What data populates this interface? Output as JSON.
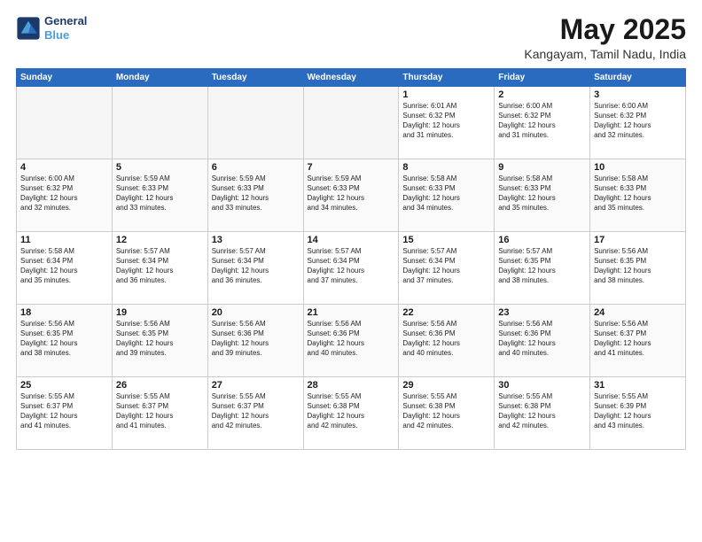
{
  "header": {
    "logo_line1": "General",
    "logo_line2": "Blue",
    "month": "May 2025",
    "location": "Kangayam, Tamil Nadu, India"
  },
  "weekdays": [
    "Sunday",
    "Monday",
    "Tuesday",
    "Wednesday",
    "Thursday",
    "Friday",
    "Saturday"
  ],
  "weeks": [
    [
      {
        "day": "",
        "info": ""
      },
      {
        "day": "",
        "info": ""
      },
      {
        "day": "",
        "info": ""
      },
      {
        "day": "",
        "info": ""
      },
      {
        "day": "1",
        "info": "Sunrise: 6:01 AM\nSunset: 6:32 PM\nDaylight: 12 hours\nand 31 minutes."
      },
      {
        "day": "2",
        "info": "Sunrise: 6:00 AM\nSunset: 6:32 PM\nDaylight: 12 hours\nand 31 minutes."
      },
      {
        "day": "3",
        "info": "Sunrise: 6:00 AM\nSunset: 6:32 PM\nDaylight: 12 hours\nand 32 minutes."
      }
    ],
    [
      {
        "day": "4",
        "info": "Sunrise: 6:00 AM\nSunset: 6:32 PM\nDaylight: 12 hours\nand 32 minutes."
      },
      {
        "day": "5",
        "info": "Sunrise: 5:59 AM\nSunset: 6:33 PM\nDaylight: 12 hours\nand 33 minutes."
      },
      {
        "day": "6",
        "info": "Sunrise: 5:59 AM\nSunset: 6:33 PM\nDaylight: 12 hours\nand 33 minutes."
      },
      {
        "day": "7",
        "info": "Sunrise: 5:59 AM\nSunset: 6:33 PM\nDaylight: 12 hours\nand 34 minutes."
      },
      {
        "day": "8",
        "info": "Sunrise: 5:58 AM\nSunset: 6:33 PM\nDaylight: 12 hours\nand 34 minutes."
      },
      {
        "day": "9",
        "info": "Sunrise: 5:58 AM\nSunset: 6:33 PM\nDaylight: 12 hours\nand 35 minutes."
      },
      {
        "day": "10",
        "info": "Sunrise: 5:58 AM\nSunset: 6:33 PM\nDaylight: 12 hours\nand 35 minutes."
      }
    ],
    [
      {
        "day": "11",
        "info": "Sunrise: 5:58 AM\nSunset: 6:34 PM\nDaylight: 12 hours\nand 35 minutes."
      },
      {
        "day": "12",
        "info": "Sunrise: 5:57 AM\nSunset: 6:34 PM\nDaylight: 12 hours\nand 36 minutes."
      },
      {
        "day": "13",
        "info": "Sunrise: 5:57 AM\nSunset: 6:34 PM\nDaylight: 12 hours\nand 36 minutes."
      },
      {
        "day": "14",
        "info": "Sunrise: 5:57 AM\nSunset: 6:34 PM\nDaylight: 12 hours\nand 37 minutes."
      },
      {
        "day": "15",
        "info": "Sunrise: 5:57 AM\nSunset: 6:34 PM\nDaylight: 12 hours\nand 37 minutes."
      },
      {
        "day": "16",
        "info": "Sunrise: 5:57 AM\nSunset: 6:35 PM\nDaylight: 12 hours\nand 38 minutes."
      },
      {
        "day": "17",
        "info": "Sunrise: 5:56 AM\nSunset: 6:35 PM\nDaylight: 12 hours\nand 38 minutes."
      }
    ],
    [
      {
        "day": "18",
        "info": "Sunrise: 5:56 AM\nSunset: 6:35 PM\nDaylight: 12 hours\nand 38 minutes."
      },
      {
        "day": "19",
        "info": "Sunrise: 5:56 AM\nSunset: 6:35 PM\nDaylight: 12 hours\nand 39 minutes."
      },
      {
        "day": "20",
        "info": "Sunrise: 5:56 AM\nSunset: 6:36 PM\nDaylight: 12 hours\nand 39 minutes."
      },
      {
        "day": "21",
        "info": "Sunrise: 5:56 AM\nSunset: 6:36 PM\nDaylight: 12 hours\nand 40 minutes."
      },
      {
        "day": "22",
        "info": "Sunrise: 5:56 AM\nSunset: 6:36 PM\nDaylight: 12 hours\nand 40 minutes."
      },
      {
        "day": "23",
        "info": "Sunrise: 5:56 AM\nSunset: 6:36 PM\nDaylight: 12 hours\nand 40 minutes."
      },
      {
        "day": "24",
        "info": "Sunrise: 5:56 AM\nSunset: 6:37 PM\nDaylight: 12 hours\nand 41 minutes."
      }
    ],
    [
      {
        "day": "25",
        "info": "Sunrise: 5:55 AM\nSunset: 6:37 PM\nDaylight: 12 hours\nand 41 minutes."
      },
      {
        "day": "26",
        "info": "Sunrise: 5:55 AM\nSunset: 6:37 PM\nDaylight: 12 hours\nand 41 minutes."
      },
      {
        "day": "27",
        "info": "Sunrise: 5:55 AM\nSunset: 6:37 PM\nDaylight: 12 hours\nand 42 minutes."
      },
      {
        "day": "28",
        "info": "Sunrise: 5:55 AM\nSunset: 6:38 PM\nDaylight: 12 hours\nand 42 minutes."
      },
      {
        "day": "29",
        "info": "Sunrise: 5:55 AM\nSunset: 6:38 PM\nDaylight: 12 hours\nand 42 minutes."
      },
      {
        "day": "30",
        "info": "Sunrise: 5:55 AM\nSunset: 6:38 PM\nDaylight: 12 hours\nand 42 minutes."
      },
      {
        "day": "31",
        "info": "Sunrise: 5:55 AM\nSunset: 6:39 PM\nDaylight: 12 hours\nand 43 minutes."
      }
    ]
  ]
}
